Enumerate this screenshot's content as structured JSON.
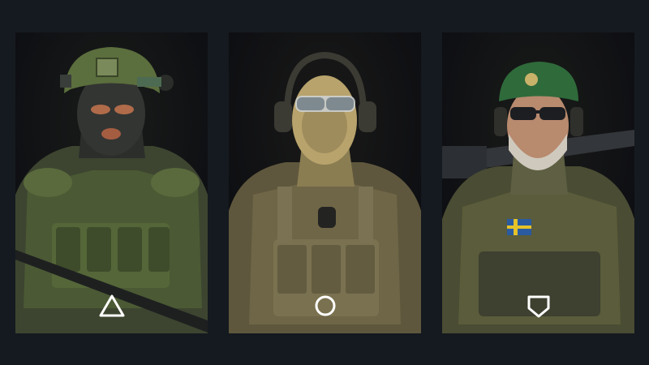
{
  "cards": [
    {
      "id": "operator-camo-helmet",
      "symbol": "triangle-icon",
      "camo_color": "#4c5a36",
      "accent": "#6b7b3c"
    },
    {
      "id": "operator-tan-balaclava",
      "symbol": "circle-icon",
      "camo_color": "#6d6444",
      "accent": "#b9a774"
    },
    {
      "id": "operator-green-beret",
      "symbol": "shield-icon",
      "camo_color": "#53563a",
      "accent": "#2f6a3a"
    }
  ],
  "colors": {
    "background": "#151a20",
    "card": "#0b0c11",
    "symbol": "#ffffff"
  }
}
